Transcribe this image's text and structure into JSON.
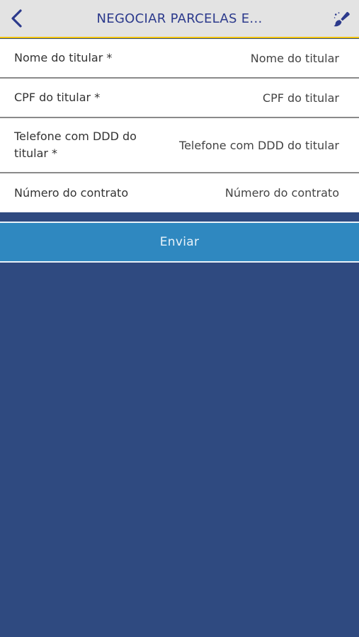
{
  "header": {
    "title": "NEGOCIAR PARCELAS E...",
    "back_icon": "chevron-left-icon",
    "action_icon": "paint-brush-icon",
    "title_color": "#2c3a8c",
    "accent_color": "#f2c40f"
  },
  "form": {
    "fields": [
      {
        "label": "Nome do titular *",
        "placeholder": "Nome do titular",
        "value": ""
      },
      {
        "label": "CPF do titular *",
        "placeholder": "CPF do titular",
        "value": ""
      },
      {
        "label": "Telefone com DDD do titular *",
        "placeholder": "Telefone com DDD do titular",
        "value": ""
      },
      {
        "label": "Número do contrato",
        "placeholder": "Número do contrato",
        "value": ""
      }
    ]
  },
  "submit": {
    "label": "Enviar",
    "color": "#2f88c0"
  },
  "background_color": "#2f4a80"
}
